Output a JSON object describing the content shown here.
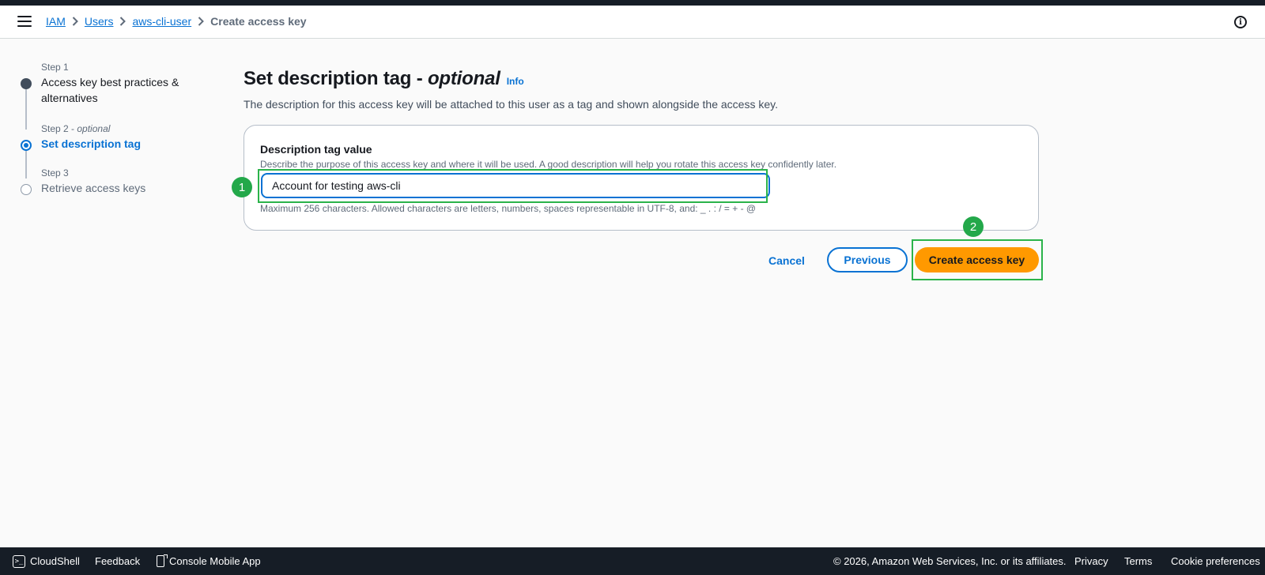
{
  "breadcrumb": {
    "items": [
      "IAM",
      "Users",
      "aws-cli-user"
    ],
    "current": "Create access key"
  },
  "steps": [
    {
      "number": "Step 1",
      "optional": "",
      "title": "Access key best practices & alternatives",
      "state": "completed"
    },
    {
      "number": "Step 2",
      "optional": "optional",
      "title": "Set description tag",
      "state": "current"
    },
    {
      "number": "Step 3",
      "optional": "",
      "title": "Retrieve access keys",
      "state": "pending"
    }
  ],
  "page": {
    "title": "Set description tag -",
    "title_optional": "optional",
    "info_link": "Info",
    "subtitle": "The description for this access key will be attached to this user as a tag and shown alongside the access key."
  },
  "form": {
    "label": "Description tag value",
    "description": "Describe the purpose of this access key and where it will be used. A good description will help you rotate this access key confidently later.",
    "value": "Account for testing aws-cli",
    "hint": "Maximum 256 characters. Allowed characters are letters, numbers, spaces representable in UTF-8, and: _ . : / = + - @"
  },
  "actions": {
    "cancel": "Cancel",
    "previous": "Previous",
    "create": "Create access key"
  },
  "annotations": {
    "badge1": "1",
    "badge2": "2"
  },
  "footer": {
    "cloudshell": "CloudShell",
    "feedback": "Feedback",
    "mobile_app": "Console Mobile App",
    "copyright": "© 2026, Amazon Web Services, Inc. or its affiliates.",
    "privacy": "Privacy",
    "terms": "Terms",
    "cookies": "Cookie preferences"
  },
  "colors": {
    "primary": "#0972d3",
    "action": "#ff9900",
    "highlight": "#2bb34a",
    "dark": "#161d26"
  },
  "icons": [
    "menu-icon",
    "chevron-right-icon",
    "info-icon",
    "cloudshell-icon",
    "mobile-app-icon"
  ]
}
